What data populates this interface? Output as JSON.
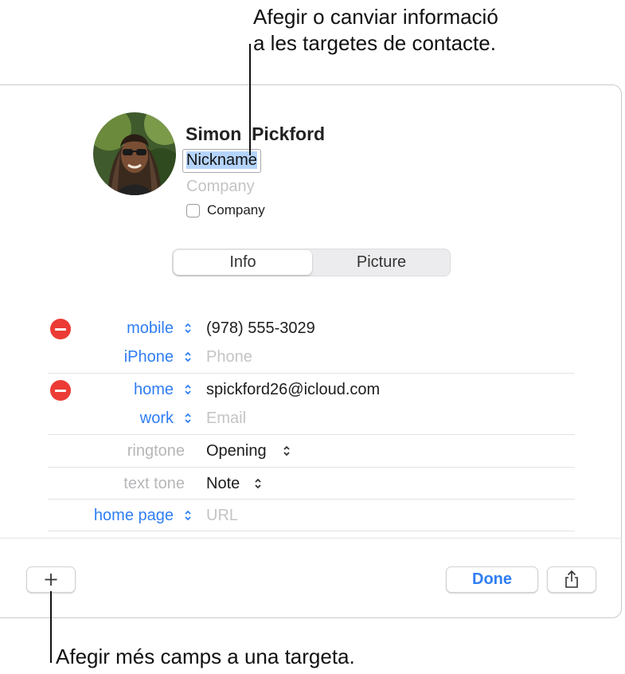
{
  "callouts": {
    "top_line1": "Afegir o canviar informació",
    "top_line2": "a les targetes de contacte.",
    "bottom": "Afegir més camps a una targeta."
  },
  "contact": {
    "first_name": "Simon",
    "last_name": "Pickford",
    "nickname": "Nickname",
    "company_placeholder": "Company",
    "company_checkbox_label": "Company",
    "company_checked": false
  },
  "tabs": {
    "info": "Info",
    "picture": "Picture",
    "selected": "Info"
  },
  "fields": {
    "phone1_label": "mobile",
    "phone1_value": "(978) 555-3029",
    "phone2_label": "iPhone",
    "phone2_placeholder": "Phone",
    "email1_label": "home",
    "email1_value": "spickford26@icloud.com",
    "email2_label": "work",
    "email2_placeholder": "Email",
    "ringtone_label": "ringtone",
    "ringtone_value": "Opening",
    "texttone_label": "text tone",
    "texttone_value": "Note",
    "homepage_label": "home page",
    "homepage_placeholder": "URL"
  },
  "footer": {
    "add_icon": "plus-icon",
    "done_label": "Done",
    "share_icon": "share-icon"
  },
  "colors": {
    "accent": "#2f7ef3",
    "remove": "#ec3b35",
    "selection": "#b5d4fb"
  }
}
